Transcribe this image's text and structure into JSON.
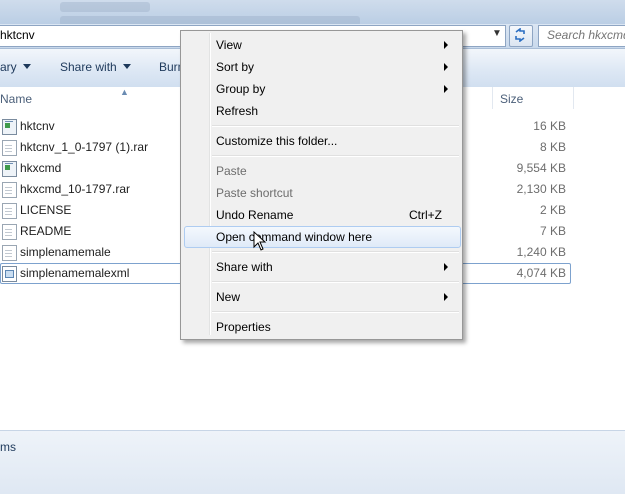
{
  "address_bar": {
    "path": "hktcnv",
    "search_placeholder": "Search hkxcmd"
  },
  "toolbar": {
    "organize_label": "ary",
    "share_label": "Share with",
    "burn_label": "Burn"
  },
  "columns": {
    "name": "Name",
    "size": "Size"
  },
  "files": [
    {
      "name": "hktcnv",
      "size": "16 KB",
      "icon": "application-icon"
    },
    {
      "name": "hktcnv_1_0-1797 (1).rar",
      "size": "8 KB",
      "icon": "document-icon"
    },
    {
      "name": "hkxcmd",
      "size": "9,554 KB",
      "icon": "application-icon"
    },
    {
      "name": "hkxcmd_10-1797.rar",
      "size": "2,130 KB",
      "icon": "document-icon"
    },
    {
      "name": "LICENSE",
      "size": "2 KB",
      "icon": "document-icon"
    },
    {
      "name": "README",
      "size": "7 KB",
      "icon": "document-icon"
    },
    {
      "name": "simplenamemale",
      "size": "1,240 KB",
      "icon": "document-icon"
    },
    {
      "name": "simplenamemalexml",
      "size": "4,074 KB",
      "icon": "xml-document-icon"
    }
  ],
  "status": {
    "text": "ms"
  },
  "context_menu": {
    "view": "View",
    "sort_by": "Sort by",
    "group_by": "Group by",
    "refresh": "Refresh",
    "customize": "Customize this folder...",
    "paste": "Paste",
    "paste_shortcut": "Paste shortcut",
    "undo_rename": "Undo Rename",
    "undo_shortcut": "Ctrl+Z",
    "open_cmd": "Open command window here",
    "share_with": "Share with",
    "new": "New",
    "properties": "Properties"
  },
  "colors": {
    "toolbar_text": "#1e395b",
    "hover_border": "#aeccf1",
    "selection_border": "#7da2ce"
  }
}
